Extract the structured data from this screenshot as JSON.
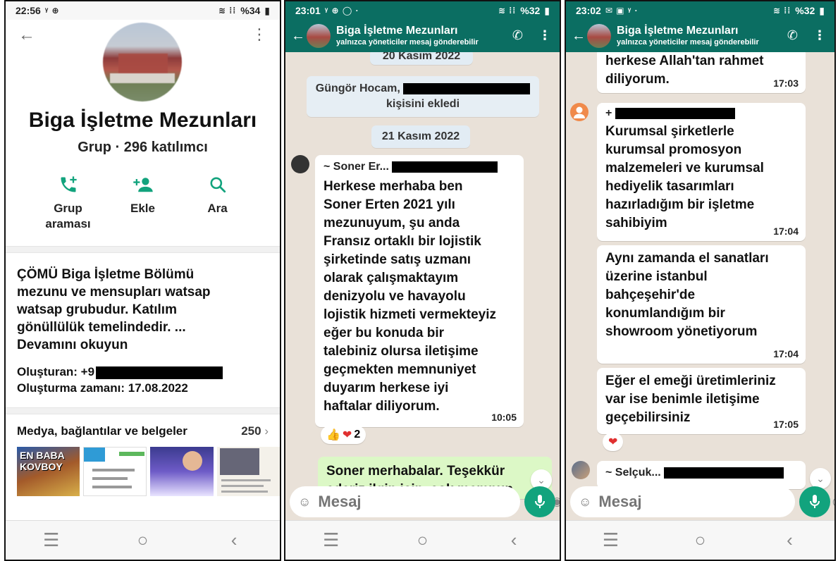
{
  "screen1": {
    "status": {
      "time": "22:56",
      "battery": "%34"
    },
    "title": "Biga İşletme Mezunları",
    "subtitle": "Grup · 296 katılımcı",
    "actions": {
      "call_line1": "Grup",
      "call_line2": "araması",
      "add": "Ekle",
      "search": "Ara"
    },
    "description_l1": "ÇÖMÜ Biga İşletme Bölümü",
    "description_l2": "mezunu ve mensupları watsap",
    "description_l3": "watsap grubudur. Katılım",
    "description_l4": "gönüllülük temelindedir. ...",
    "read_more": "Devamını okuyun",
    "created_by_label": "Oluşturan: +9",
    "created_at": "Oluşturma zamanı: 17.08.2022",
    "media_label": "Medya, bağlantılar ve belgeler",
    "media_count": "250",
    "media_chevron": "›",
    "thumb1_text": "EN BABA KOVBOY"
  },
  "screen2": {
    "status": {
      "time": "23:01",
      "battery": "%32"
    },
    "group_name": "Biga İşletme Mezunları",
    "group_sub": "yalnızca yöneticiler mesaj gönderebilir",
    "date1": "20 Kasım 2022",
    "system_l1": "Güngör Hocam,",
    "system_l2": "kişisini ekledi",
    "date2": "21 Kasım 2022",
    "sender": "~ Soner Er...",
    "message_lines": [
      "Herkese merhaba ben",
      "Soner Erten 2021 yılı",
      "mezunuyum, şu anda",
      "Fransız ortaklı bir lojistik",
      "şirketinde satış uzmanı",
      "olarak çalışmaktayım",
      "denizyolu ve havayolu",
      "lojistik hizmeti vermekteyiz",
      "eğer bu konuda bir",
      "talebiniz olursa iletişime",
      "geçmekten memnuniyet",
      "duyarım herkese iyi",
      "haftalar diliyorum."
    ],
    "message_time": "10:05",
    "reaction_count": "2",
    "reply_l1": "Soner merhabalar. Teşekkür",
    "reply_l2": "ederiz ilgin için, çok memnun",
    "input_placeholder": "Mesaj"
  },
  "screen3": {
    "status": {
      "time": "23:02",
      "battery": "%32"
    },
    "group_name": "Biga İşletme Mezunları",
    "group_sub": "yalnızca yöneticiler mesaj gönderebilir",
    "msg0_l1": "herkese Allah'tan rahmet",
    "msg0_l2": "diliyorum.",
    "msg0_time": "17:03",
    "msg1_prefix": "+",
    "msg1_lines": [
      "Kurumsal şirketlerle",
      "kurumsal promosyon",
      "malzemeleri ve kurumsal",
      "hediyelik tasarımları",
      "hazırladığım bir işletme",
      "sahibiyim"
    ],
    "msg1_time": "17:04",
    "msg2_lines": [
      "Aynı zamanda el sanatları",
      "üzerine istanbul",
      "bahçeşehir'de",
      "konumlandığım bir",
      "showroom yönetiyorum"
    ],
    "msg2_time": "17:04",
    "msg3_lines": [
      "Eğer el emeği üretimleriniz",
      "var ise benimle iletişime",
      "geçebilirsiniz"
    ],
    "msg3_time": "17:05",
    "sender2": "~ Selçuk...",
    "input_placeholder": "Mesaj"
  },
  "colors": {
    "wa_green": "#0b6e62",
    "accent": "#12a37d",
    "chat_bg": "#e9e1d8"
  }
}
